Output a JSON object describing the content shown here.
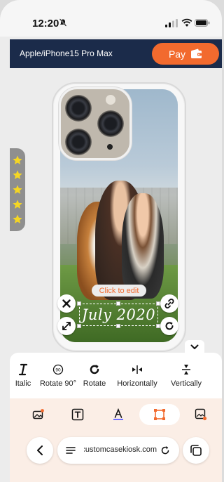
{
  "status_bar": {
    "time": "12:20"
  },
  "header": {
    "model": "Apple/iPhone15 Pro Max",
    "pay_label": "Pay"
  },
  "side_rating": {
    "stars": 5
  },
  "editor": {
    "hint": "Click to edit",
    "text": "July 2020"
  },
  "tools": [
    {
      "label": "Italic",
      "icon": "italic-icon"
    },
    {
      "label": "Rotate 90°",
      "icon": "rotate-90-icon"
    },
    {
      "label": "Rotate",
      "icon": "rotate-icon"
    },
    {
      "label": "Horizontally",
      "icon": "flip-horizontal-icon"
    },
    {
      "label": "Vertically",
      "icon": "flip-vertical-icon"
    }
  ],
  "bottom_tabs": [
    {
      "icon": "image-add-icon",
      "active": false
    },
    {
      "icon": "text-box-icon",
      "active": false
    },
    {
      "icon": "font-color-icon",
      "active": false
    },
    {
      "icon": "frame-icon",
      "active": true
    },
    {
      "icon": "sticker-icon",
      "active": false
    }
  ],
  "browser": {
    "url": "customcasekiosk.com"
  },
  "colors": {
    "accent": "#f26a2e",
    "header_bg": "#1b2b4a",
    "star": "#f5d623"
  }
}
